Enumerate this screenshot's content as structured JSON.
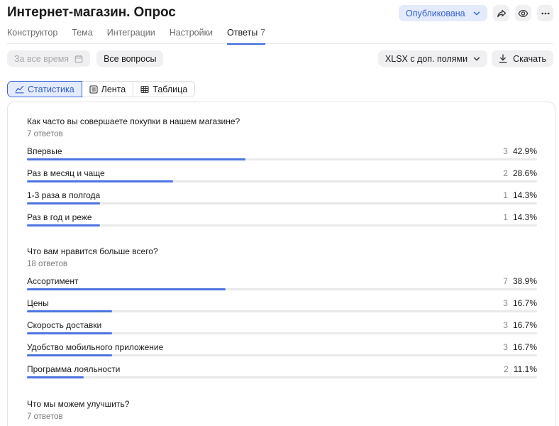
{
  "header": {
    "title": "Интернет-магазин. Опрос",
    "status_label": "Опубликована",
    "icons": [
      "share-icon",
      "eye-icon",
      "more-icon"
    ]
  },
  "tabs": [
    {
      "label": "Конструктор",
      "active": false
    },
    {
      "label": "Тема",
      "active": false
    },
    {
      "label": "Интеграции",
      "active": false
    },
    {
      "label": "Настройки",
      "active": false
    },
    {
      "label": "Ответы",
      "count": "7",
      "active": true
    }
  ],
  "filters": {
    "period_label": "За все время",
    "questions_label": "Все вопросы",
    "export_format_label": "XLSX с доп. полями",
    "download_label": "Скачать"
  },
  "views": [
    {
      "label": "Статистика",
      "active": true,
      "icon": "stats-icon"
    },
    {
      "label": "Лента",
      "active": false,
      "icon": "feed-icon"
    },
    {
      "label": "Таблица",
      "active": false,
      "icon": "table-icon"
    }
  ],
  "colors": {
    "accent": "#3a66db",
    "bar": "#4d74e0",
    "track": "#e9e9ec",
    "status_bg": "#e3ebfc"
  },
  "questions": [
    {
      "title": "Как часто вы совершаете покупки в нашем магазине?",
      "responses": "7 ответов",
      "options": [
        {
          "label": "Впервые",
          "count": "3",
          "percent": "42.9%",
          "fraction": 0.429
        },
        {
          "label": "Раз в месяц и чаще",
          "count": "2",
          "percent": "28.6%",
          "fraction": 0.286
        },
        {
          "label": "1-3 раза в полгода",
          "count": "1",
          "percent": "14.3%",
          "fraction": 0.143
        },
        {
          "label": "Раз в год и реже",
          "count": "1",
          "percent": "14.3%",
          "fraction": 0.143
        }
      ]
    },
    {
      "title": "Что вам нравится больше всего?",
      "responses": "18 ответов",
      "options": [
        {
          "label": "Ассортимент",
          "count": "7",
          "percent": "38.9%",
          "fraction": 0.389
        },
        {
          "label": "Цены",
          "count": "3",
          "percent": "16.7%",
          "fraction": 0.167
        },
        {
          "label": "Скорость доставки",
          "count": "3",
          "percent": "16.7%",
          "fraction": 0.167
        },
        {
          "label": "Удобство мобильного приложение",
          "count": "3",
          "percent": "16.7%",
          "fraction": 0.167
        },
        {
          "label": "Программа лояльности",
          "count": "2",
          "percent": "11.1%",
          "fraction": 0.111
        }
      ]
    },
    {
      "title": "Что мы можем улучшить?",
      "responses": "7 ответов",
      "options": []
    }
  ]
}
